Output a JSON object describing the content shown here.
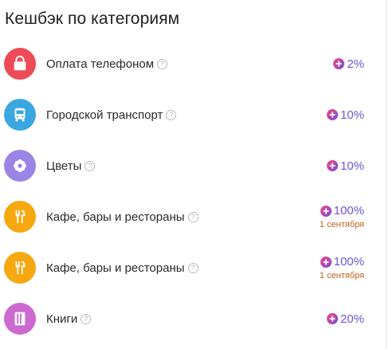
{
  "title": "Кешбэк по категориям",
  "categories": [
    {
      "label": "Оплата телефоном",
      "percent": "2%",
      "date": "",
      "icon": "shopping-bag-icon",
      "color": "#ef4a57"
    },
    {
      "label": "Городской транспорт",
      "percent": "10%",
      "date": "",
      "icon": "bus-icon",
      "color": "#3aa7e0"
    },
    {
      "label": "Цветы",
      "percent": "10%",
      "date": "",
      "icon": "flower-icon",
      "color": "#9a84e6"
    },
    {
      "label": "Кафе, бары и рестораны",
      "percent": "100%",
      "date": "1 сентября",
      "icon": "fork-knife-icon",
      "color": "#f5a80f"
    },
    {
      "label": "Кафе, бары и рестораны",
      "percent": "100%",
      "date": "1 сентября",
      "icon": "fork-knife-icon",
      "color": "#f5a80f"
    },
    {
      "label": "Книги",
      "percent": "20%",
      "date": "",
      "icon": "book-icon",
      "color": "#cc6ad1"
    }
  ],
  "help_glyph": "?",
  "colors": {
    "percent": "#6d55d6",
    "date": "#c0601e",
    "coin_start": "#f2457a",
    "coin_end": "#7a4ce0"
  }
}
